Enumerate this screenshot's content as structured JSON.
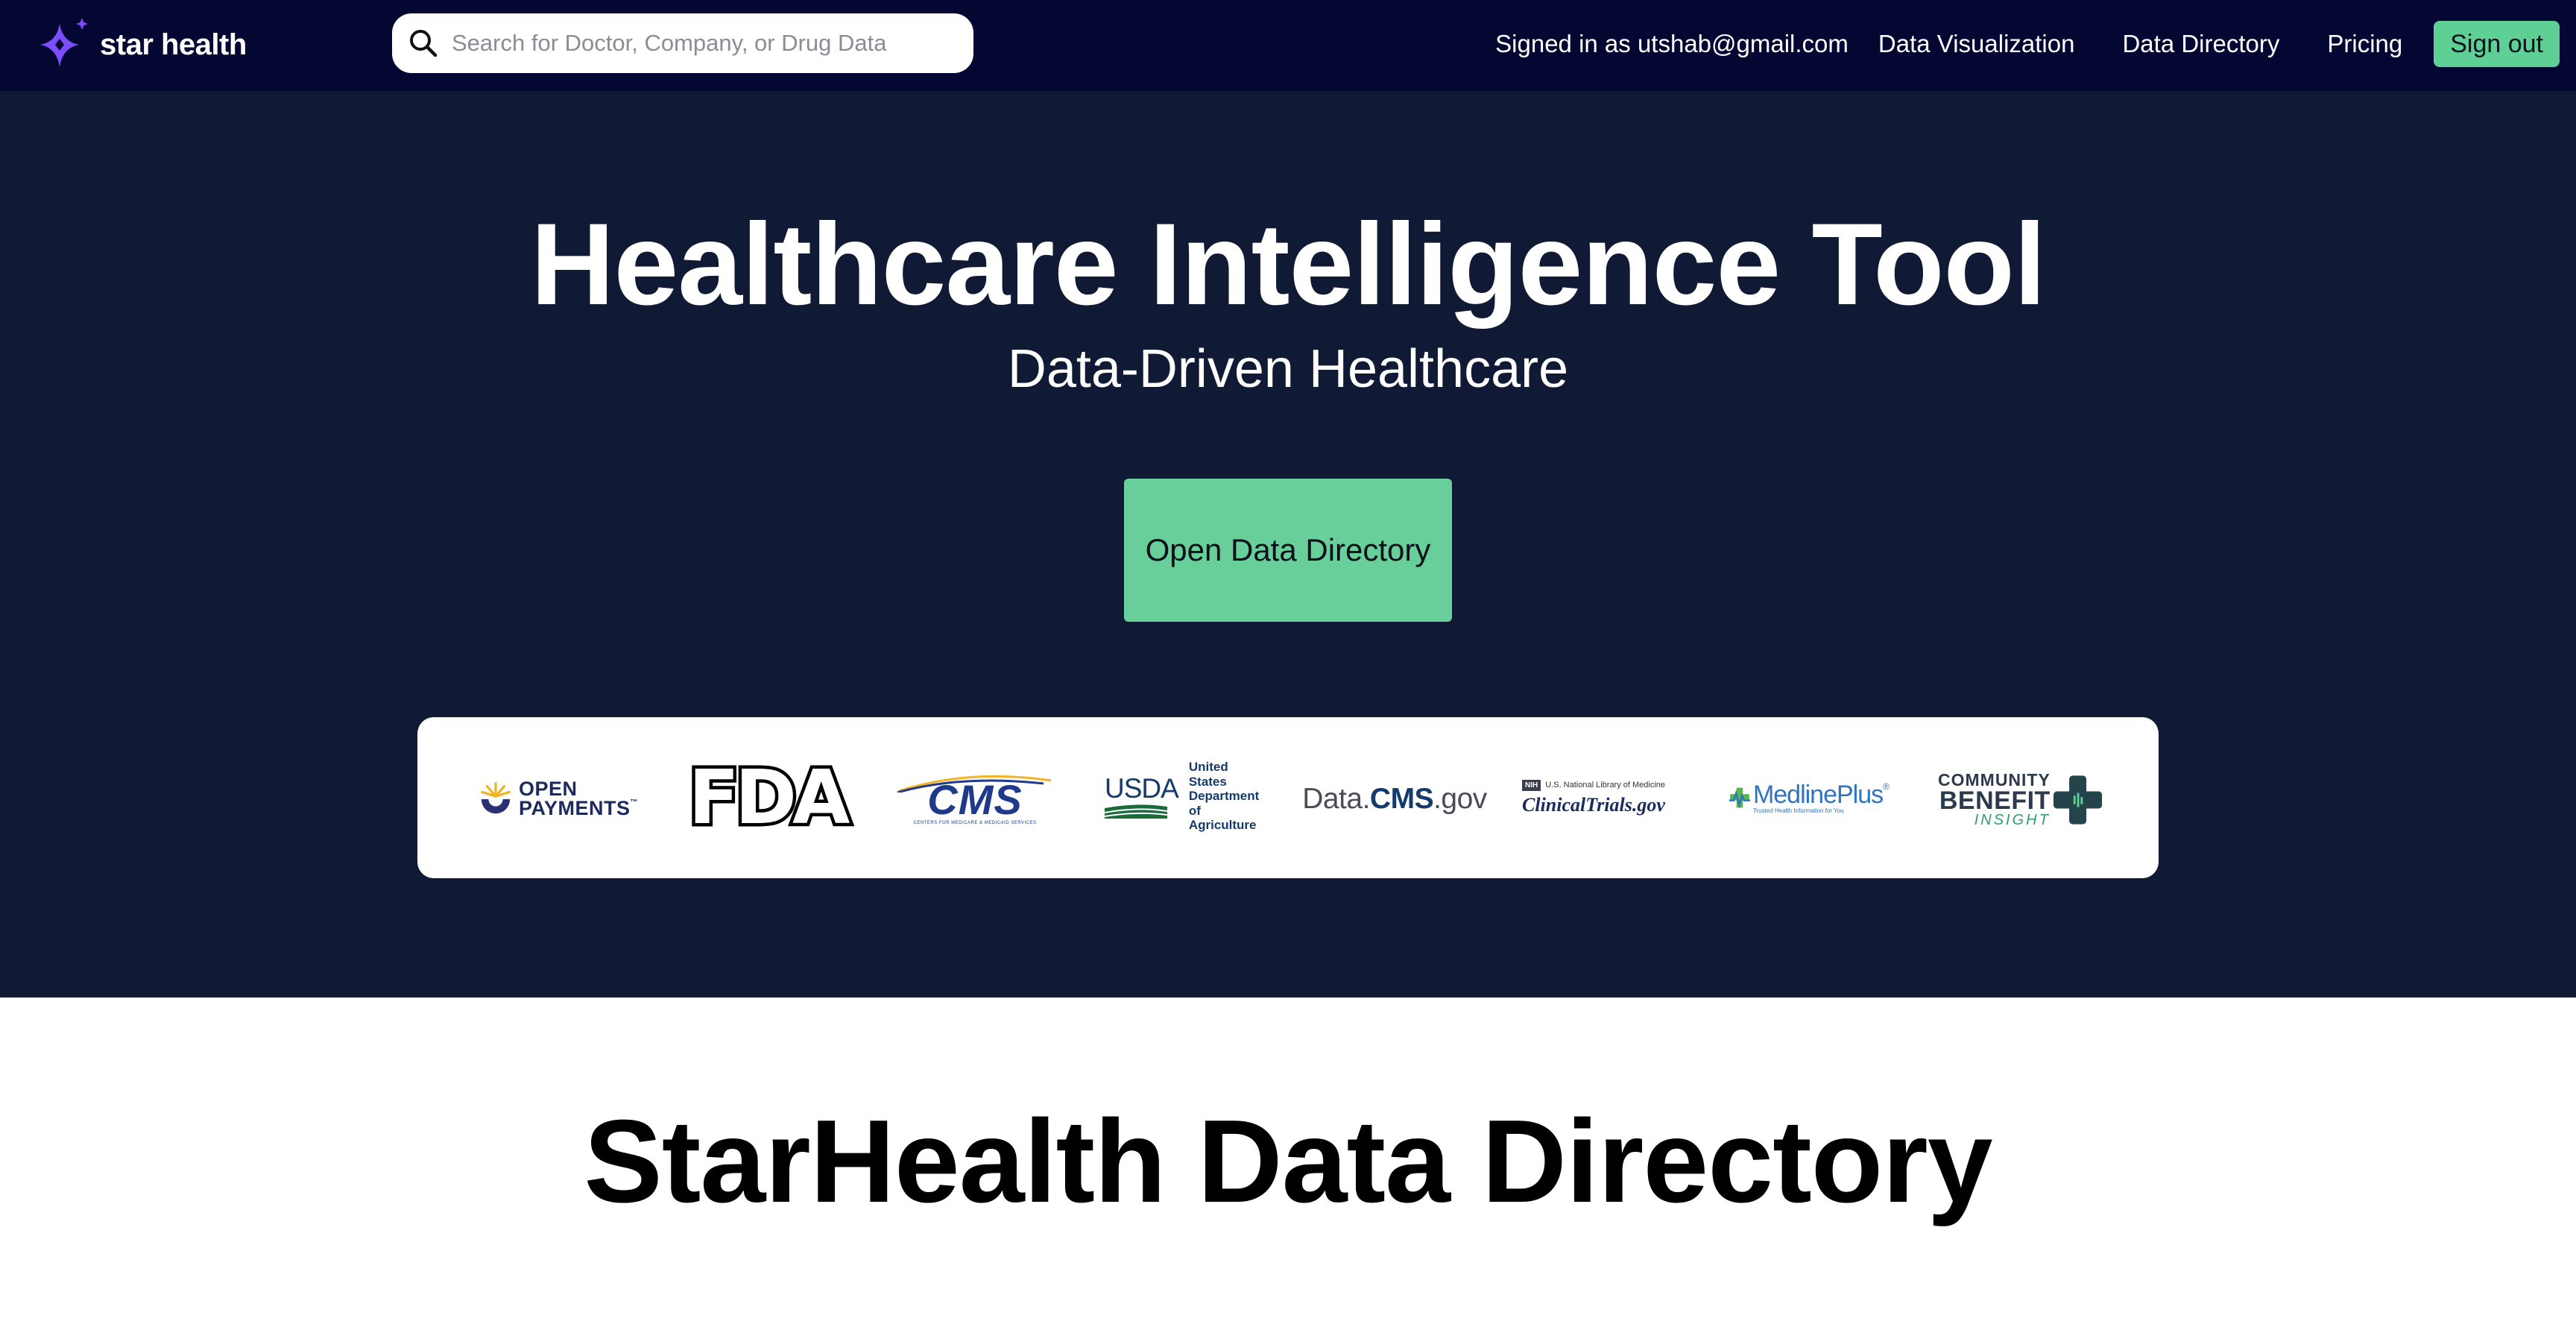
{
  "brand": {
    "name": "star health",
    "logo_icon": "star-cluster-icon"
  },
  "search": {
    "placeholder": "Search for Doctor, Company, or Drug Data",
    "value": "",
    "icon": "search-icon"
  },
  "nav": {
    "signed_in": "Signed in as utshab@gmail.com",
    "links": [
      "Data Visualization",
      "Data Directory",
      "Pricing"
    ],
    "sign_out": "Sign out"
  },
  "hero": {
    "title": "Healthcare Intelligence Tool",
    "subtitle": "Data-Driven Healthcare",
    "cta_label": "Open Data Directory"
  },
  "partners": {
    "open_payments": {
      "line1": "OPEN",
      "line2": "PAYMENTS",
      "tm": "™"
    },
    "fda": {
      "text": "FDA"
    },
    "cms": {
      "text": "CMS",
      "sub": "CENTERS FOR MEDICARE & MEDICAID SERVICES"
    },
    "usda": {
      "text": "USDA",
      "dept_line1": "United States",
      "dept_line2": "Department of",
      "dept_line3": "Agriculture"
    },
    "data_cms": {
      "prefix": "Data.",
      "bold": "CMS",
      "suffix": ".gov"
    },
    "clinical_trials": {
      "badge": "NIH",
      "top": "U.S. National Library of Medicine",
      "main": "ClinicalTrials.gov"
    },
    "medline_plus": {
      "text": "MedlinePlus",
      "tm": "®",
      "sub": "Trusted Health Information for You"
    },
    "community_benefit": {
      "line1": "COMMUNITY",
      "line2": "BENEFIT",
      "line3": "INSIGHT"
    }
  },
  "section": {
    "title": "StarHealth Data Directory"
  },
  "colors": {
    "topbar": "#050733",
    "hero_bg": "#111a35",
    "accent_green": "#68cf9b",
    "brand_purple": "#7b4dff"
  }
}
